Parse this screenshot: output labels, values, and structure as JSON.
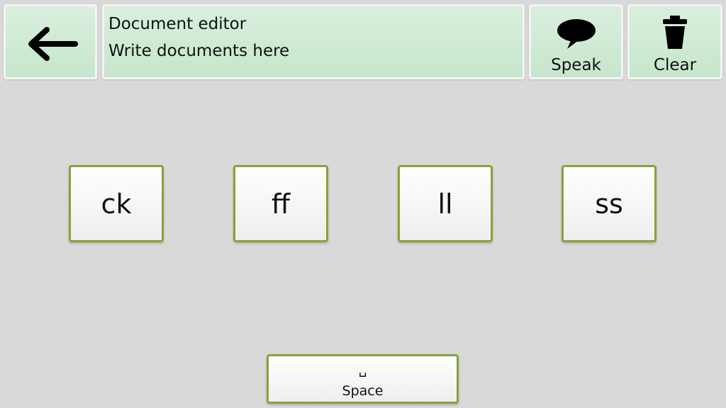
{
  "header": {
    "back_icon": "arrow-left-icon",
    "document": {
      "line1": "Document editor",
      "line2": "Write documents here"
    },
    "speak": {
      "label": "Speak",
      "icon": "speech-bubble-icon"
    },
    "clear": {
      "label": "Clear",
      "icon": "trash-icon"
    }
  },
  "keys": [
    {
      "label": "ck"
    },
    {
      "label": "ff"
    },
    {
      "label": "ll"
    },
    {
      "label": "ss"
    }
  ],
  "space_key": {
    "glyph": "␣",
    "label": "Space"
  },
  "colors": {
    "background": "#d9d9d9",
    "header_button": "#c6e6cc",
    "key_border": "#86a33a"
  }
}
